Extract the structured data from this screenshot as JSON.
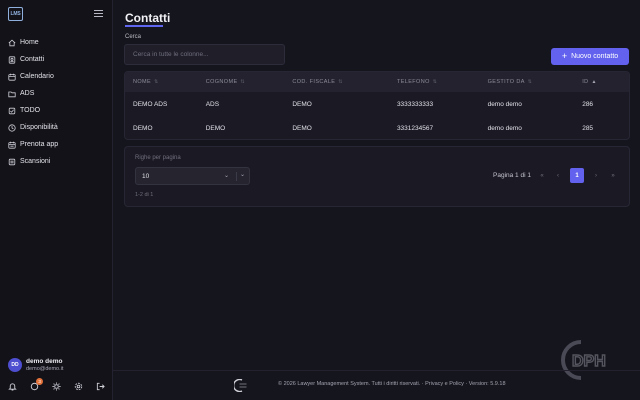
{
  "app": {
    "logo_text": "LMS"
  },
  "sidebar": {
    "items": [
      {
        "label": "Home",
        "icon": "home-icon"
      },
      {
        "label": "Contatti",
        "icon": "contacts-icon"
      },
      {
        "label": "Calendario",
        "icon": "calendar-icon"
      },
      {
        "label": "ADS",
        "icon": "folder-icon"
      },
      {
        "label": "TODO",
        "icon": "checkbox-icon"
      },
      {
        "label": "Disponibilità",
        "icon": "clock-icon"
      },
      {
        "label": "Prenota app",
        "icon": "booking-icon"
      },
      {
        "label": "Scansioni",
        "icon": "scan-icon"
      }
    ],
    "user": {
      "initials": "DD",
      "name": "demo demo",
      "email": "demo@demo.it"
    },
    "notification_count": "3"
  },
  "main": {
    "title": "Contatti",
    "search": {
      "label": "Cerca",
      "placeholder": "Cerca in tutte le colonne...",
      "value": ""
    },
    "new_button": "Nuovo contatto",
    "table": {
      "columns": [
        "NOME",
        "COGNOME",
        "COD. FISCALE",
        "TELEFONO",
        "GESTITO DA",
        "ID"
      ],
      "sort_column": "ID",
      "rows": [
        [
          "DEMO ADS",
          "ADS",
          "DEMO",
          "3333333333",
          "demo demo",
          "286"
        ],
        [
          "DEMO",
          "DEMO",
          "DEMO",
          "3331234567",
          "demo demo",
          "285"
        ]
      ]
    },
    "pagination": {
      "rows_label": "Righe per pagina",
      "rows_value": "10",
      "range": "1-2 di 1",
      "page_info": "Pagina 1 di 1",
      "first": "«",
      "prev": "‹",
      "current": "1",
      "next": "›",
      "last": "»"
    }
  },
  "footer": {
    "text": "© 2026 Lawyer Management System. Tutti i diritti riservati. · Privacy e Policy · Version: 5.9.18",
    "logo_text": "DPH"
  },
  "colors": {
    "accent": "#6262ee",
    "background": "#15151d",
    "sidebar": "#131219",
    "badge": "#e2723a"
  }
}
